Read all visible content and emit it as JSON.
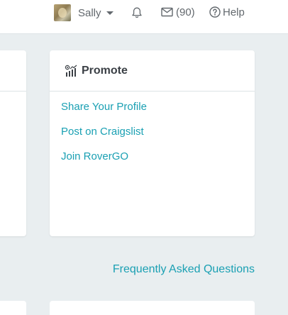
{
  "nav": {
    "user_name": "Sally",
    "mail_count": "(90)",
    "help_label": "Help",
    "icons": [
      "avatar",
      "chevron-down-icon",
      "bell-icon",
      "mail-icon",
      "help-circle-icon"
    ]
  },
  "promote": {
    "title": "Promote",
    "icon": "promote-chart-icon",
    "links": [
      "Share Your Profile",
      "Post on Craigslist",
      "Join RoverGO"
    ]
  },
  "footer": {
    "faq_label": "Frequently Asked Questions"
  },
  "colors": {
    "link": "#1aa0b3",
    "background": "#e9eef0",
    "text": "#62686d",
    "heading": "#3b4046"
  }
}
